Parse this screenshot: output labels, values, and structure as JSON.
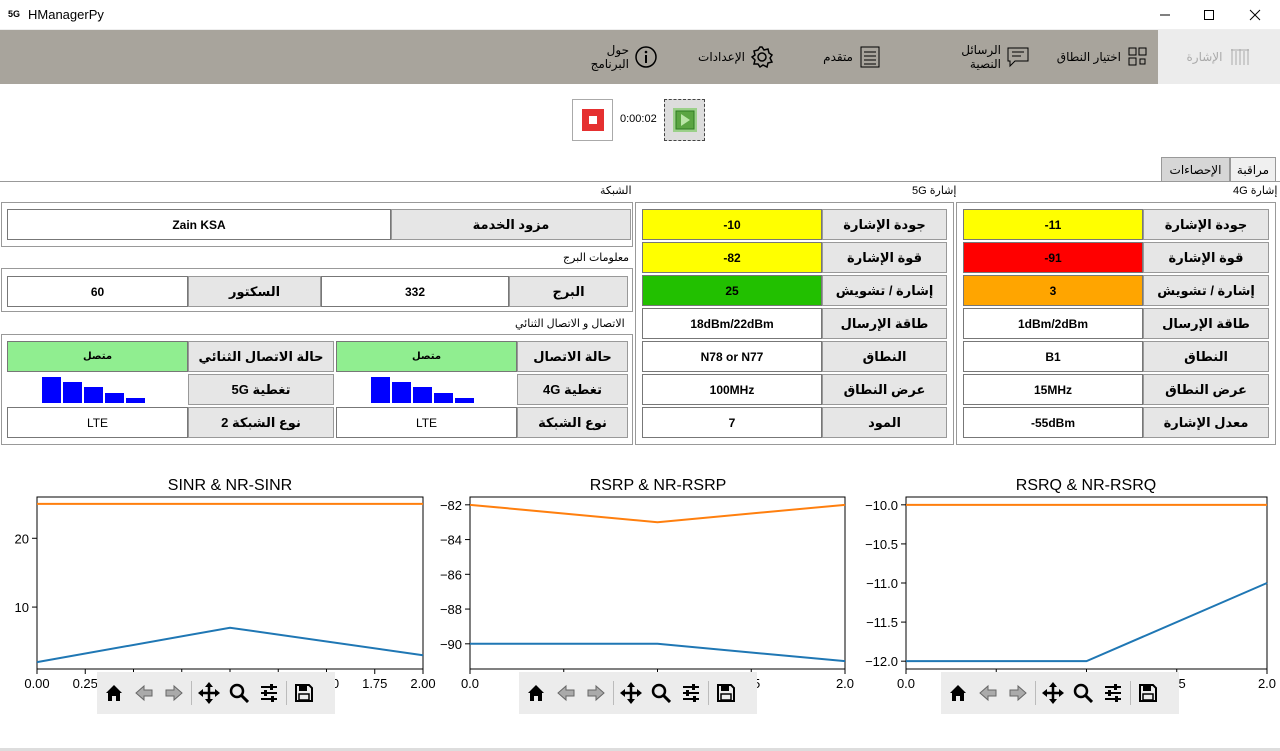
{
  "window": {
    "icon_text": "5G",
    "title": "HManagerPy"
  },
  "toolbar": {
    "signal": "الإشارة",
    "band_select": "اختيار النطاق",
    "sms": "الرسائل النصية",
    "advanced": "متقدم",
    "settings": "الإعدادات",
    "about": "حول البرنامج"
  },
  "controls": {
    "timer": "0:00:02"
  },
  "tabs": {
    "monitor": "مراقبة",
    "stats": "الإحصاءات"
  },
  "network": {
    "group_label": "الشبكة",
    "provider_label": "مزود الخدمة",
    "provider_value": "Zain KSA",
    "tower_group_label": "معلومات البرج",
    "tower_label": "البرج",
    "tower_value": "332",
    "sector_label": "السكتور",
    "sector_value": "60",
    "conn_group_label": "الاتصال و الاتصال الثنائي",
    "conn_status_label": "حالة الاتصال",
    "conn_status_value": "متصل",
    "dual_status_label": "حالة الاتصال الثنائي",
    "dual_status_value": "متصل",
    "cov4g_label": "تغطية 4G",
    "cov5g_label": "تغطية 5G",
    "nettype_label": "نوع الشبكة",
    "nettype_value": "LTE",
    "nettype2_label": "نوع الشبكة 2",
    "nettype2_value": "LTE",
    "cov4g_bars": 5,
    "cov5g_bars": 5
  },
  "signal5g": {
    "group_label": "إشارة 5G",
    "rows": [
      {
        "label": "جودة الإشارة",
        "value": "-10",
        "color": "#ffff00"
      },
      {
        "label": "قوة الإشارة",
        "value": "-82",
        "color": "#ffff00"
      },
      {
        "label": "إشارة / تشويش",
        "value": "25",
        "color": "#22c000"
      },
      {
        "label": "طاقة الإرسال",
        "value": "18dBm/22dBm",
        "color": "#ffffff"
      },
      {
        "label": "النطاق",
        "value": "N78 or N77",
        "color": "#ffffff"
      },
      {
        "label": "عرض النطاق",
        "value": "100MHz",
        "color": "#ffffff"
      },
      {
        "label": "المود",
        "value": "7",
        "color": "#ffffff"
      }
    ]
  },
  "signal4g": {
    "group_label": "إشارة 4G",
    "rows": [
      {
        "label": "جودة الإشارة",
        "value": "-11",
        "color": "#ffff00"
      },
      {
        "label": "قوة الإشارة",
        "value": "-91",
        "color": "#ff0000"
      },
      {
        "label": "إشارة / تشويش",
        "value": "3",
        "color": "#ffa500"
      },
      {
        "label": "طاقة الإرسال",
        "value": "1dBm/2dBm",
        "color": "#ffffff"
      },
      {
        "label": "النطاق",
        "value": "B1",
        "color": "#ffffff"
      },
      {
        "label": "عرض النطاق",
        "value": "15MHz",
        "color": "#ffffff"
      },
      {
        "label": "معدل الإشارة",
        "value": "-55dBm",
        "color": "#ffffff"
      }
    ]
  },
  "chart_data": [
    {
      "type": "line",
      "title": "SINR & NR-SINR",
      "xlim": [
        0,
        2
      ],
      "ylim": [
        1,
        26
      ],
      "xticks": [
        "0.00",
        "0.25",
        "0.50",
        "0.75",
        "1.00",
        "1.25",
        "1.50",
        "1.75",
        "2.00"
      ],
      "xtick_values": [
        0,
        0.25,
        0.5,
        0.75,
        1,
        1.25,
        1.5,
        1.75,
        2
      ],
      "yticks": [
        "10",
        "20"
      ],
      "ytick_values": [
        10,
        20
      ],
      "x": [
        0,
        1,
        2
      ],
      "series": [
        {
          "values": [
            2,
            7,
            3
          ],
          "color": "#1f77b4"
        },
        {
          "values": [
            25,
            25,
            25
          ],
          "color": "#ff7f0e"
        }
      ]
    },
    {
      "type": "line",
      "title": "RSRP & NR-RSRP",
      "xlim": [
        0,
        2
      ],
      "ylim": [
        -91.45,
        -81.55
      ],
      "xticks": [
        "0.0",
        "0.5",
        "1.0",
        "1.5",
        "2.0"
      ],
      "xtick_values": [
        0,
        0.5,
        1,
        1.5,
        2
      ],
      "yticks": [
        "−90",
        "−88",
        "−86",
        "−84",
        "−82"
      ],
      "ytick_values": [
        -90,
        -88,
        -86,
        -84,
        -82
      ],
      "x": [
        0,
        1,
        2
      ],
      "series": [
        {
          "values": [
            -90,
            -90,
            -91
          ],
          "color": "#1f77b4"
        },
        {
          "values": [
            -82,
            -83,
            -82
          ],
          "color": "#ff7f0e"
        }
      ]
    },
    {
      "type": "line",
      "title": "RSRQ & NR-RSRQ",
      "xlim": [
        0,
        2
      ],
      "ylim": [
        -12.1,
        -9.9
      ],
      "xticks": [
        "0.0",
        "0.5",
        "1.0",
        "1.5",
        "2.0"
      ],
      "xtick_values": [
        0,
        0.5,
        1,
        1.5,
        2
      ],
      "yticks": [
        "−12.0",
        "−11.5",
        "−11.0",
        "−10.5",
        "−10.0"
      ],
      "ytick_values": [
        -12,
        -11.5,
        -11,
        -10.5,
        -10
      ],
      "x": [
        0,
        1,
        2
      ],
      "series": [
        {
          "values": [
            -12,
            -12,
            -11
          ],
          "color": "#1f77b4"
        },
        {
          "values": [
            -10,
            -10,
            -10
          ],
          "color": "#ff7f0e"
        }
      ]
    }
  ]
}
